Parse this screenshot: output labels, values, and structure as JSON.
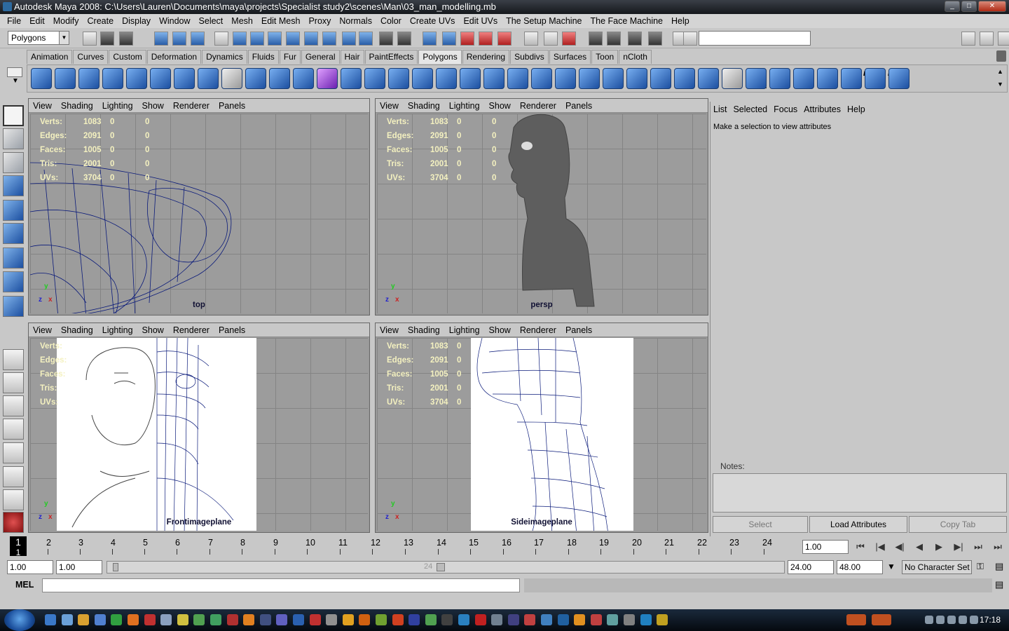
{
  "window": {
    "title": "Autodesk Maya 2008: C:\\Users\\Lauren\\Documents\\maya\\projects\\Specialist study2\\scenes\\Man\\03_man_modelling.mb",
    "buttons": [
      "_",
      "□",
      "✕"
    ]
  },
  "menus": [
    "File",
    "Edit",
    "Modify",
    "Create",
    "Display",
    "Window",
    "Select",
    "Mesh",
    "Edit Mesh",
    "Proxy",
    "Normals",
    "Color",
    "Create UVs",
    "Edit UVs",
    "The Setup Machine",
    "The Face Machine",
    "Help"
  ],
  "status": {
    "mode": "Polygons"
  },
  "shelf_tabs": [
    "Animation",
    "Curves",
    "Custom",
    "Deformation",
    "Dynamics",
    "Fluids",
    "Fur",
    "General",
    "Hair",
    "PaintEffects",
    "Polygons",
    "Rendering",
    "Subdivs",
    "Surfaces",
    "Toon",
    "nCloth"
  ],
  "active_shelf": "Polygons",
  "shelf_labels": [
    "DE",
    "mel",
    "mel"
  ],
  "viewport_menu": [
    "View",
    "Shading",
    "Lighting",
    "Show",
    "Renderer",
    "Panels"
  ],
  "hud_labels": [
    "Verts:",
    "Edges:",
    "Faces:",
    "Tris:",
    "UVs:"
  ],
  "viewports": [
    {
      "name": "top",
      "values": [
        [
          "1083",
          "0",
          "0"
        ],
        [
          "2091",
          "0",
          "0"
        ],
        [
          "1005",
          "0",
          "0"
        ],
        [
          "2001",
          "0",
          "0"
        ],
        [
          "3704",
          "0",
          "0"
        ]
      ]
    },
    {
      "name": "persp",
      "values": [
        [
          "1083",
          "0",
          "0"
        ],
        [
          "2091",
          "0",
          "0"
        ],
        [
          "1005",
          "0",
          "0"
        ],
        [
          "2001",
          "0",
          "0"
        ],
        [
          "3704",
          "0",
          "0"
        ]
      ]
    },
    {
      "name": "Frontimageplane",
      "values": [
        [],
        [],
        [],
        [],
        []
      ]
    },
    {
      "name": "Sideimageplane",
      "values": [
        [
          "1083",
          "0"
        ],
        [
          "2091",
          "0"
        ],
        [
          "1005",
          "0"
        ],
        [
          "2001",
          "0"
        ],
        [
          "3704",
          "0"
        ]
      ]
    }
  ],
  "axis": {
    "y": "y",
    "z": "z",
    "x": "x"
  },
  "attribute_editor": {
    "menu": [
      "List",
      "Selected",
      "Focus",
      "Attributes",
      "Help"
    ],
    "message": "Make a selection to view attributes",
    "notes_label": "Notes:",
    "select": "Select",
    "load": "Load Attributes",
    "copy": "Copy Tab"
  },
  "timeline": {
    "current": "1",
    "ticks": [
      "2",
      "3",
      "4",
      "5",
      "6",
      "7",
      "8",
      "9",
      "10",
      "11",
      "12",
      "13",
      "14",
      "15",
      "16",
      "17",
      "18",
      "19",
      "20",
      "21",
      "22",
      "23",
      "24"
    ],
    "current_time": "1.00"
  },
  "range": {
    "start": "1.00",
    "playback_start": "1.00",
    "playback_end": "24.00",
    "end": "48.00",
    "bar_label": "24",
    "character_set": "No Character Set"
  },
  "mel": {
    "label": "MEL"
  },
  "taskbar": {
    "time": "17:18"
  }
}
